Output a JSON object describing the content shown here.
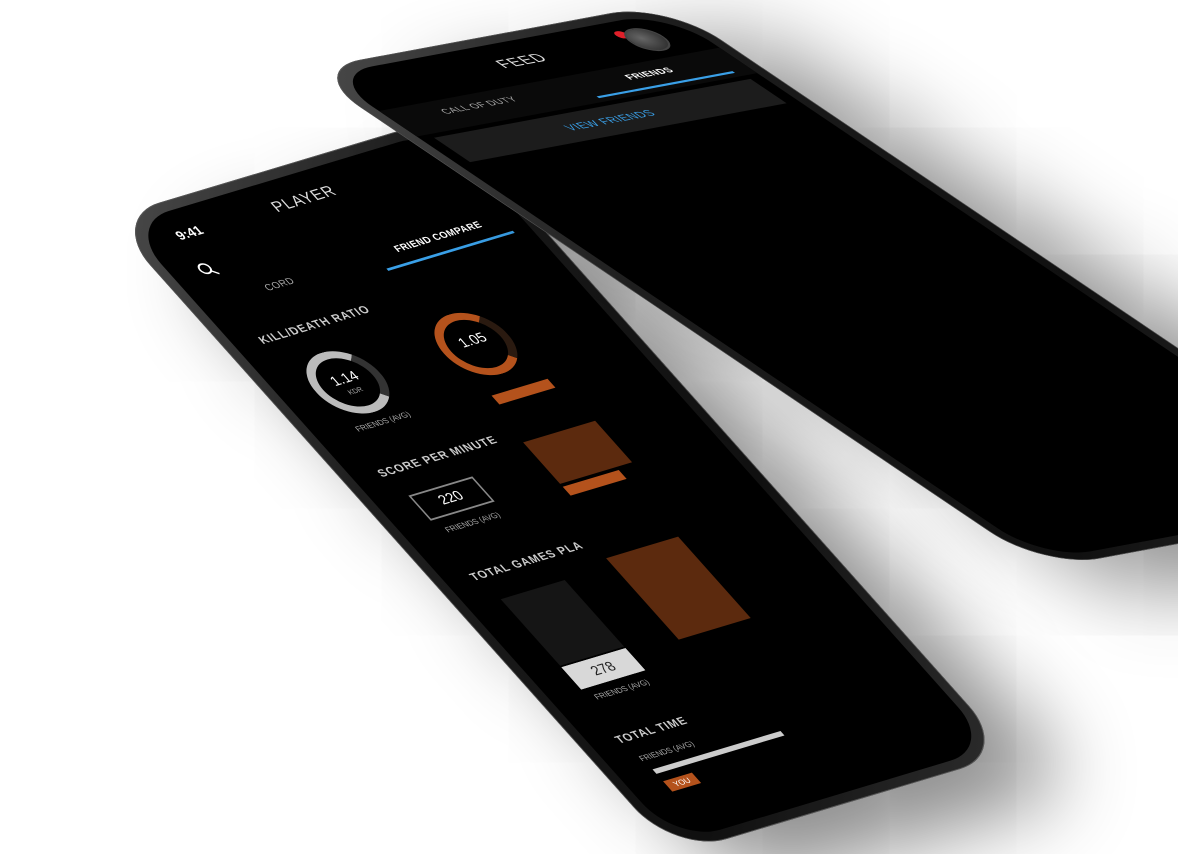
{
  "back_phone": {
    "status_time": "9:41",
    "title": "PLAYER",
    "tabs": [
      "CORD",
      "FRIEND COMPARE"
    ],
    "kdr": {
      "label": "KILL/DEATH RATIO",
      "friends_value": "1.14",
      "unit": "KDR",
      "you_value": "1.05",
      "caption": "FRIENDS (AVG)"
    },
    "spm": {
      "label": "SCORE PER MINUTE",
      "friends_value": "220",
      "caption": "FRIENDS (AVG)"
    },
    "games": {
      "label": "TOTAL GAMES PLA",
      "friends_value": "278",
      "caption": "FRIENDS (AVG)"
    },
    "time": {
      "label": "TOTAL TIME",
      "caption": "FRIENDS (AVG)",
      "you_label": "YOU"
    }
  },
  "front_phone": {
    "title": "FEED",
    "notification_badge": "",
    "tabs": [
      {
        "label": "CALL OF DUTY",
        "active": false
      },
      {
        "label": "FRIENDS",
        "active": true
      }
    ],
    "view_friends_label": "VIEW FRIENDS"
  },
  "colors": {
    "accent_blue": "#3aa0e8",
    "accent_orange": "#b4521c",
    "background": "#000000"
  },
  "icons": {
    "search": "search-icon",
    "avatar": "avatar"
  }
}
